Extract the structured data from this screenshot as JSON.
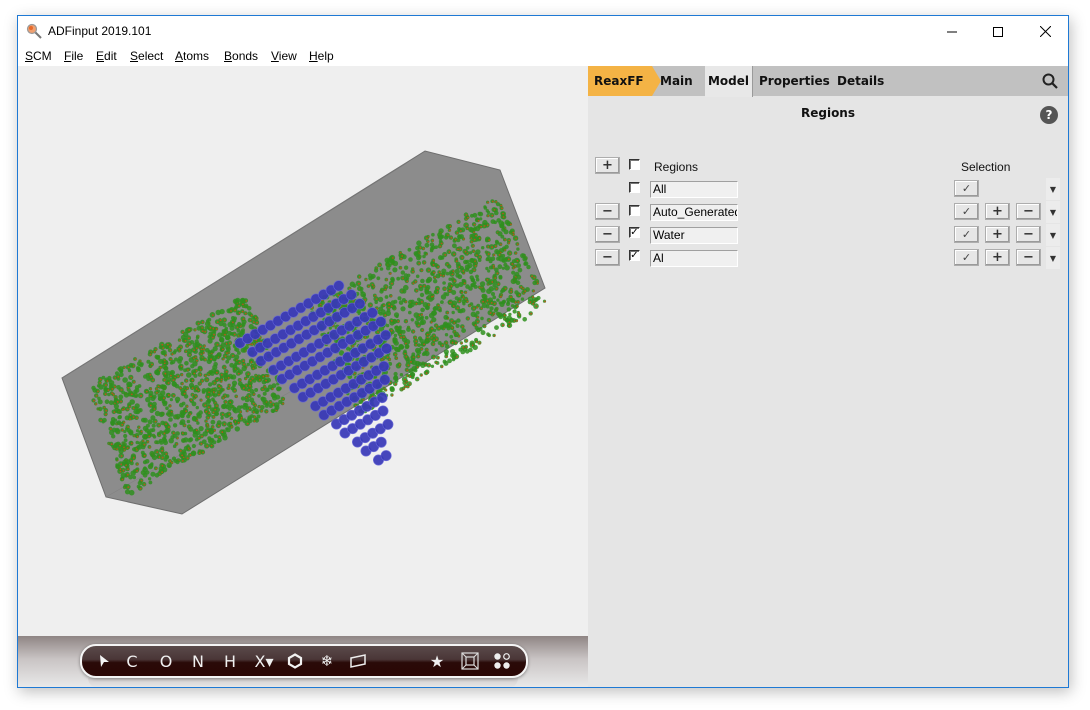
{
  "window": {
    "title": "ADFinput 2019.101",
    "controls": {
      "minimize": "minimize-icon",
      "maximize": "maximize-icon",
      "close": "close-icon"
    }
  },
  "menubar": {
    "items": [
      {
        "label": "SCM",
        "mnemonic": "S"
      },
      {
        "label": "File",
        "mnemonic": "F"
      },
      {
        "label": "Edit",
        "mnemonic": "E"
      },
      {
        "label": "Select",
        "mnemonic": "S"
      },
      {
        "label": "Atoms",
        "mnemonic": "A"
      },
      {
        "label": "Bonds",
        "mnemonic": "B"
      },
      {
        "label": "View",
        "mnemonic": "V"
      },
      {
        "label": "Help",
        "mnemonic": "H"
      }
    ]
  },
  "viewport": {
    "scene": "Periodic simulation box with water molecules (green/red) on both sides of an Al slab (blue spheres)",
    "colors": {
      "box": "#8c8c8c",
      "water": "#2f8f1f",
      "oxygen": "#b5561a",
      "aluminum": "#3838b8"
    }
  },
  "toolbar": {
    "tools": [
      {
        "name": "select-tool",
        "glyph": "➤"
      },
      {
        "name": "carbon-tool",
        "glyph": "C"
      },
      {
        "name": "oxygen-tool",
        "glyph": "O"
      },
      {
        "name": "nitrogen-tool",
        "glyph": "N"
      },
      {
        "name": "hydrogen-tool",
        "glyph": "H"
      },
      {
        "name": "other-element-tool",
        "glyph": "X▾"
      },
      {
        "name": "ring-tool",
        "glyph": "⬡"
      },
      {
        "name": "freeze-tool",
        "glyph": "❄"
      },
      {
        "name": "plane-tool",
        "glyph": "▱"
      },
      {
        "name": "favorite-tool",
        "glyph": "★"
      },
      {
        "name": "box-view-tool",
        "glyph": "⊠"
      },
      {
        "name": "molecules-tool",
        "glyph": "⁘"
      }
    ]
  },
  "panel": {
    "tabs": [
      {
        "label": "ReaxFF",
        "state": "engine"
      },
      {
        "label": "Main",
        "state": "normal"
      },
      {
        "label": "Model",
        "state": "active"
      },
      {
        "label": "Properties",
        "state": "normal"
      },
      {
        "label": "Details",
        "state": "normal"
      }
    ],
    "accent": "#f4b345",
    "section_title": "Regions",
    "help_label": "?",
    "table": {
      "add_label": "+",
      "header_regions": "Regions",
      "header_selection": "Selection",
      "rows": [
        {
          "name": "All",
          "checked": false,
          "removable": false,
          "select": "✓",
          "add": null,
          "remove": null
        },
        {
          "name": "Auto_Generated",
          "checked": false,
          "removable": true,
          "select": "✓",
          "add": "+",
          "remove": "−"
        },
        {
          "name": "Water",
          "checked": true,
          "removable": true,
          "select": "✓",
          "add": "+",
          "remove": "−"
        },
        {
          "name": "Al",
          "checked": true,
          "removable": true,
          "select": "✓",
          "add": "+",
          "remove": "−"
        }
      ],
      "remove_label": "−",
      "check_mark": "✓"
    }
  }
}
